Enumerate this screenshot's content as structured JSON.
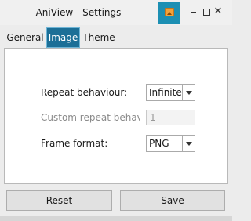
{
  "window": {
    "title": "AniView - Settings",
    "app_icon": "image-icon",
    "controls": {
      "minimize_icon": "minimize-icon",
      "maximize_icon": "maximize-icon",
      "close_glyph": "✕"
    }
  },
  "tabs": [
    {
      "label": "General",
      "selected": false
    },
    {
      "label": "Image",
      "selected": true
    },
    {
      "label": "Theme",
      "selected": false
    }
  ],
  "settings": {
    "repeat_behaviour": {
      "label": "Repeat behaviour:",
      "value": "Infinite"
    },
    "custom_repeat": {
      "label": "Custom repeat behavio",
      "value": "1",
      "disabled": true
    },
    "frame_format": {
      "label": "Frame format:",
      "value": "PNG"
    }
  },
  "buttons": {
    "reset": "Reset",
    "save": "Save"
  },
  "colors": {
    "accent": "#1c6f97",
    "icon_bg": "#1c8fb3",
    "window_bg": "#ececec",
    "panel_bg": "#ffffff"
  }
}
